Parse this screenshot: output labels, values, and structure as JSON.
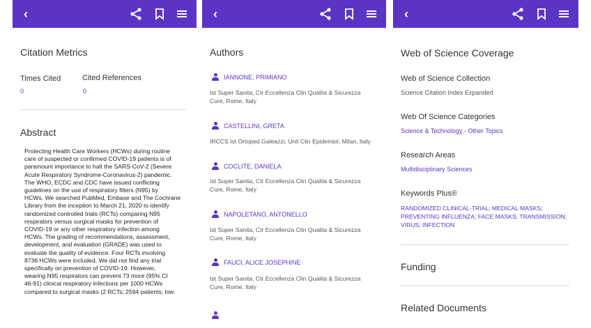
{
  "colors": {
    "brand": "#5b34c6"
  },
  "icons": {
    "back": "chevron-left-icon",
    "share": "share-icon",
    "bookmark": "bookmark-icon",
    "menu": "menu-icon"
  },
  "panel1": {
    "title": "Citation Metrics",
    "times_cited_label": "Times Cited",
    "times_cited_value": "0",
    "cited_refs_label": "Cited References",
    "cited_refs_value": "0",
    "abstract_title": "Abstract",
    "abstract_lines": [
      "Protecting Health Care Workers (HCWs) during routine",
      "care of suspected or confirmed COVID-19 patients is of",
      "paramount importance to halt the SARS-CoV-2 (Severe",
      "Acute Respiratory Syndrome-Coronavirus-2) pandemic.",
      "The WHO, ECDC and CDC have issued conflicting",
      "guidelines on the use of respiratory filters (N95) by",
      "HCWs. We searched PubMed, Embase and The Cochrane",
      "Library from the inception to March 21, 2020 to identify",
      "randomized controlled trials (RCTs) comparing N95",
      "respirators versus surgical masks for prevention of",
      "COVID-19 or any other respiratory infection among",
      "HCWs. The grading of recommendations, assessment,",
      "development, and evaluation (GRADE) was used to",
      "evaluate the quality of evidence. Four RCTs involving",
      "8736 HCWs were included. We did not find any trial",
      "specifically on prevention of COVID-19. However,",
      "wearing N95 respirators can prevent 73 more (95% CI",
      "46-91) clinical respiratory infections per 1000 HCWs",
      "compared to surgical masks (2 RCTs; 2594 patients; low"
    ]
  },
  "panel2": {
    "title": "Authors",
    "authors": [
      {
        "name": "IANNONE, PRIMIANO",
        "aff_lines": [
          "Ist Super Sanita, Ctr Eccellenza Clin Qualita & Sicurezza",
          "Cure, Rome, Italy"
        ]
      },
      {
        "name": "CASTELLINI, GRETA",
        "aff_lines": [
          "IRCCS Ist Ortoped Galeazzi, Unit Clin Epidemiol, Milan, Italy"
        ]
      },
      {
        "name": "COCLITE, DANIELA",
        "aff_lines": [
          "Ist Super Sanita, Ctr Eccellenza Clin Qualita & Sicurezza",
          "Cure, Rome, Italy"
        ]
      },
      {
        "name": "NAPOLETANO, ANTONELLO",
        "aff_lines": [
          "Ist Super Sanita, Ctr Eccellenza Clin Qualita & Sicurezza",
          "Cure, Rome, Italy"
        ]
      },
      {
        "name": "FAUCI, ALICE JOSEPHINE",
        "aff_lines": [
          "Ist Super Sanita, Ctr Eccellenza Clin Qualita & Sicurezza",
          "Cure, Rome, Italy"
        ]
      }
    ]
  },
  "panel3": {
    "title": "Web of Science Coverage",
    "collection_label": "Web of Science Collection",
    "collection_value": "Science Citation Index Expanded",
    "categories_label": "Web Of Science Categories",
    "categories_value": "Science & Technology - Other Topics",
    "areas_label": "Research Areas",
    "areas_value": "Multidisciplinary Sciences",
    "keywords_label": "Keywords Plus®",
    "keywords_lines": [
      "RANDOMIZED CLINICAL-TRIAL; MEDICAL MASKS;",
      "PREVENTING INFLUENZA; FACE MASKS; TRANSMISSION;",
      "VIRUS; INFECTION"
    ],
    "funding_title": "Funding",
    "related_title": "Related Documents"
  }
}
